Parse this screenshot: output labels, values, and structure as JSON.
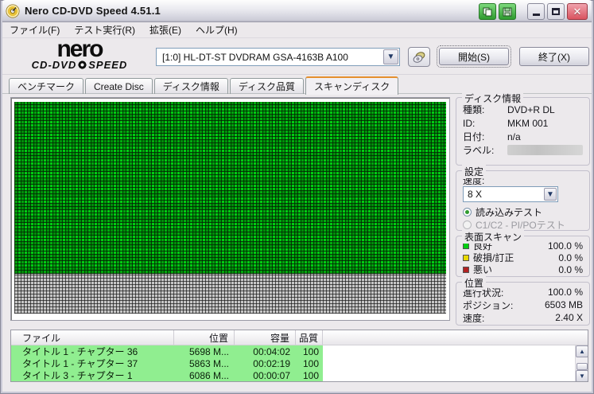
{
  "window": {
    "title": "Nero CD-DVD Speed 4.51.1",
    "controls": {
      "copy": "copy",
      "save": "save",
      "minimize": "minimize",
      "maximize": "maximize",
      "close": "close"
    }
  },
  "menu": {
    "items": [
      "ファイル(F)",
      "テスト実行(R)",
      "拡張(E)",
      "ヘルプ(H)"
    ]
  },
  "toolbar": {
    "logo_top": "nero",
    "logo_left": "CD-DVD",
    "logo_right": "SPEED",
    "drive_selected": "[1:0]   HL-DT-ST DVDRAM GSA-4163B A100",
    "start_label": "開始(S)",
    "exit_label": "終了(X)"
  },
  "tabs": [
    {
      "label": "ベンチマーク",
      "active": false
    },
    {
      "label": "Create Disc",
      "active": false
    },
    {
      "label": "ディスク情報",
      "active": false
    },
    {
      "label": "ディスク品質",
      "active": false
    },
    {
      "label": "スキャンディスク",
      "active": true
    }
  ],
  "disc_info": {
    "title": "ディスク情報",
    "rows": [
      {
        "label": "種類:",
        "value": "DVD+R DL"
      },
      {
        "label": "ID:",
        "value": "MKM 001"
      },
      {
        "label": "日付:",
        "value": "n/a"
      },
      {
        "label": "ラベル:",
        "value": ""
      }
    ]
  },
  "settings": {
    "title": "設定",
    "speed_label": "速度:",
    "speed_value": "8 X",
    "radios": [
      {
        "label": "読み込みテスト",
        "selected": true,
        "enabled": true
      },
      {
        "label": "C1/C2 - PI/POテスト",
        "selected": false,
        "enabled": false
      }
    ]
  },
  "surface_scan": {
    "title": "表面スキャン",
    "rows": [
      {
        "label": "良好",
        "value": "100.0 %",
        "color": "#00cd12"
      },
      {
        "label": "破損/訂正",
        "value": "0.0 %",
        "color": "#e8d900"
      },
      {
        "label": "悪い",
        "value": "0.0 %",
        "color": "#b22222"
      }
    ]
  },
  "position": {
    "title": "位置",
    "rows": [
      {
        "label": "進行状況:",
        "value": "100.0 %"
      },
      {
        "label": "ポジション:",
        "value": "6503 MB"
      },
      {
        "label": "速度:",
        "value": "2.40 X"
      }
    ]
  },
  "file_table": {
    "columns": [
      "ファイル",
      "位置",
      "容量",
      "品質"
    ],
    "rows": [
      [
        "タイトル 1 - チャプター 36",
        "5698 M...",
        "00:04:02",
        "100"
      ],
      [
        "タイトル 1 - チャプター 37",
        "5863 M...",
        "00:02:19",
        "100"
      ],
      [
        "タイトル 3 - チャプター 1",
        "6086 M...",
        "00:00:07",
        "100"
      ]
    ]
  },
  "colors": {
    "scan_good": "#00cd12",
    "scan_unscanned": "#c6c6c6",
    "row_highlight": "#90ee90",
    "active_tab_accent": "#e5902e"
  }
}
